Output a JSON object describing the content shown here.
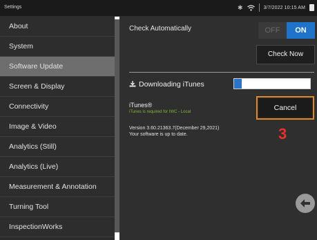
{
  "statusbar": {
    "title": "Settings",
    "bluetooth_icon": "bluetooth-icon",
    "wifi_icon": "wifi-icon",
    "datetime": "3/7/2022 10:15 AM",
    "battery_icon": "battery-icon"
  },
  "sidebar": {
    "items": [
      {
        "label": "About"
      },
      {
        "label": "System"
      },
      {
        "label": "Software Update",
        "active": true
      },
      {
        "label": "Screen & Display"
      },
      {
        "label": "Connectivity"
      },
      {
        "label": "Image & Video"
      },
      {
        "label": "Analytics (Still)"
      },
      {
        "label": "Analytics (Live)"
      },
      {
        "label": "Measurement & Annotation"
      },
      {
        "label": "Turning Tool"
      },
      {
        "label": "InspectionWorks"
      }
    ]
  },
  "main": {
    "check_automatically_label": "Check Automatically",
    "toggle": {
      "off_label": "OFF",
      "on_label": "ON",
      "value": "ON"
    },
    "check_now_label": "Check Now",
    "download": {
      "icon": "download-icon",
      "label": "Downloading iTunes",
      "progress": 0.1
    },
    "itunes_name": "iTunes®",
    "itunes_note": "iTunes is required for IWC - Local",
    "cancel_label": "Cancel",
    "version_line1": "Version 3.60.21363.7(December 29,2021)",
    "version_line2": "Your software is up to date.",
    "step_number": "3",
    "back_icon": "back-arrow-icon"
  },
  "colors": {
    "accent_blue": "#1f73c9",
    "highlight_orange": "#e08a2c",
    "step_red": "#e8302a",
    "note_green": "#7fb83a"
  }
}
